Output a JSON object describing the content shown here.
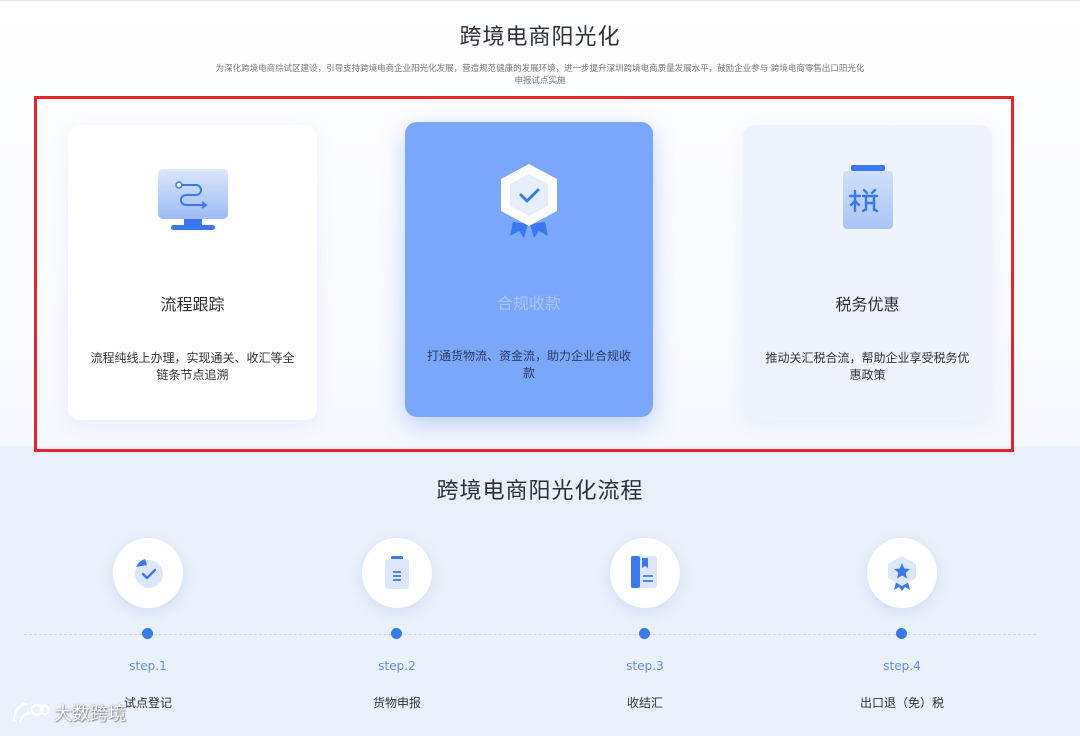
{
  "header": {
    "title": "跨境电商阳光化",
    "intro_line1": "为深化跨境电商综试区建设，引导支持跨境电商企业阳光化发展，营造规范健康的发展环境，进一步提升深圳跨境电商质量发展水平，鼓励企业参与 跨境电商零售出口阳光化",
    "intro_line2": "申报试点实施"
  },
  "cards": [
    {
      "title": "流程跟踪",
      "desc": "流程纯线上办理，实现通关、收汇等全链条节点追溯",
      "icon": "monitor-route-icon"
    },
    {
      "title": "合规收款",
      "desc": "打通货物流、资金流，助力企业合规收款",
      "icon": "shield-check-icon"
    },
    {
      "title": "税务优惠",
      "desc": "推动关汇税合流，帮助企业享受税务优惠政策",
      "icon": "tax-document-icon"
    }
  ],
  "flow": {
    "title": "跨境电商阳光化流程",
    "steps": [
      {
        "label": "step.1",
        "name": "试点登记",
        "icon": "check-badge-icon"
      },
      {
        "label": "step.2",
        "name": "货物申报",
        "icon": "document-list-icon"
      },
      {
        "label": "step.3",
        "name": "收结汇",
        "icon": "bookmark-doc-icon"
      },
      {
        "label": "step.4",
        "name": "出口退（免）税",
        "icon": "star-shield-icon"
      }
    ]
  },
  "watermark": {
    "text": "大数跨境"
  },
  "colors": {
    "accent": "#3a78f2",
    "highlight_frame": "#e3262d",
    "active_card": "#7aa7fb"
  }
}
